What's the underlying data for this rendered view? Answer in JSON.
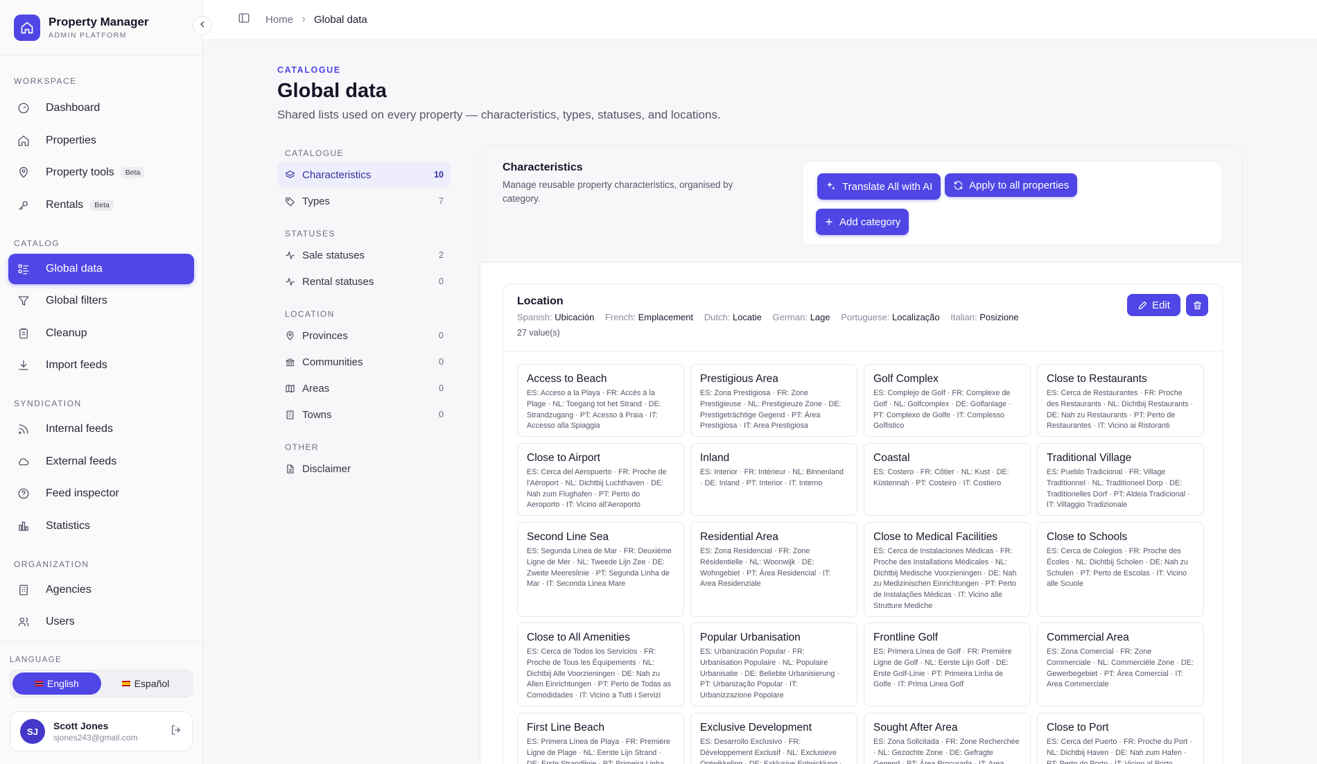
{
  "brand": {
    "title": "Property Manager",
    "subtitle": "ADMIN PLATFORM"
  },
  "sidebar": {
    "sections": [
      {
        "label": "WORKSPACE",
        "items": [
          {
            "label": "Dashboard",
            "icon": "gauge-icon"
          },
          {
            "label": "Properties",
            "icon": "home-icon"
          },
          {
            "label": "Property tools",
            "icon": "pin-icon",
            "badge": "Beta"
          },
          {
            "label": "Rentals",
            "icon": "key-icon",
            "badge": "Beta"
          }
        ]
      },
      {
        "label": "CATALOG",
        "items": [
          {
            "label": "Global data",
            "icon": "list-icon",
            "active": true
          },
          {
            "label": "Global filters",
            "icon": "filter-icon"
          },
          {
            "label": "Cleanup",
            "icon": "clipboard-icon"
          },
          {
            "label": "Import feeds",
            "icon": "download-icon"
          }
        ]
      },
      {
        "label": "SYNDICATION",
        "items": [
          {
            "label": "Internal feeds",
            "icon": "rss-icon"
          },
          {
            "label": "External feeds",
            "icon": "cloud-icon"
          },
          {
            "label": "Feed inspector",
            "icon": "help-icon"
          },
          {
            "label": "Statistics",
            "icon": "bar-chart-icon"
          }
        ]
      },
      {
        "label": "ORGANIZATION",
        "items": [
          {
            "label": "Agencies",
            "icon": "building-icon"
          },
          {
            "label": "Users",
            "icon": "users-icon"
          }
        ]
      }
    ],
    "language": {
      "label": "LANGUAGE",
      "options": [
        "English",
        "Español"
      ],
      "selected": "English"
    },
    "user": {
      "initials": "SJ",
      "name": "Scott Jones",
      "email": "sjones243@gmail.com"
    }
  },
  "breadcrumb": {
    "home": "Home",
    "current": "Global data"
  },
  "page": {
    "eyebrow": "CATALOGUE",
    "title": "Global data",
    "description": "Shared lists used on every property — characteristics, types, statuses, and locations."
  },
  "subnav": [
    {
      "label": "CATALOGUE",
      "items": [
        {
          "label": "Characteristics",
          "count": "10",
          "icon": "layers-icon",
          "active": true
        },
        {
          "label": "Types",
          "count": "7",
          "icon": "tag-icon"
        }
      ]
    },
    {
      "label": "STATUSES",
      "items": [
        {
          "label": "Sale statuses",
          "count": "2",
          "icon": "activity-icon"
        },
        {
          "label": "Rental statuses",
          "count": "0",
          "icon": "activity-icon"
        }
      ]
    },
    {
      "label": "LOCATION",
      "items": [
        {
          "label": "Provinces",
          "count": "0",
          "icon": "pin-icon"
        },
        {
          "label": "Communities",
          "count": "0",
          "icon": "landmark-icon"
        },
        {
          "label": "Areas",
          "count": "0",
          "icon": "map-icon"
        },
        {
          "label": "Towns",
          "count": "0",
          "icon": "building-icon"
        }
      ]
    },
    {
      "label": "OTHER",
      "items": [
        {
          "label": "Disclaimer",
          "count": "",
          "icon": "file-icon"
        }
      ]
    }
  ],
  "panel": {
    "title": "Characteristics",
    "description": "Manage reusable property characteristics, organised by category.",
    "buttons": {
      "translate": "Translate All with AI",
      "apply": "Apply to all properties",
      "add": "Add category"
    },
    "group": {
      "title": "Location",
      "translations": [
        {
          "lang": "Spanish:",
          "value": "Ubicación"
        },
        {
          "lang": "French:",
          "value": "Emplacement"
        },
        {
          "lang": "Dutch:",
          "value": "Locatie"
        },
        {
          "lang": "German:",
          "value": "Lage"
        },
        {
          "lang": "Portuguese:",
          "value": "Localização"
        },
        {
          "lang": "Italian:",
          "value": "Posizione"
        }
      ],
      "count": "27 value(s)",
      "edit_label": "Edit",
      "values": [
        {
          "title": "Access to Beach",
          "tr": "ES: Acceso a la Playa · FR: Accès à la Plage · NL: Toegang tot het Strand · DE: Strandzugang · PT: Acesso à Praia · IT: Accesso alla Spiaggia"
        },
        {
          "title": "Prestigious Area",
          "tr": "ES: Zona Prestigiosa · FR: Zone Prestigieuse · NL: Prestigieuze Zone · DE: Prestigeträchtige Gegend · PT: Área Prestigiosa · IT: Area Prestigiosa"
        },
        {
          "title": "Golf Complex",
          "tr": "ES: Complejo de Golf · FR: Complexe de Golf · NL: Golfcomplex · DE: Golfanlage · PT: Complexo de Golfe · IT: Complesso Golfistico"
        },
        {
          "title": "Close to Restaurants",
          "tr": "ES: Cerca de Restaurantes · FR: Proche des Restaurants · NL: Dichtbij Restaurants · DE: Nah zu Restaurants · PT: Perto de Restaurantes · IT: Vicino ai Ristoranti"
        },
        {
          "title": "Close to Airport",
          "tr": "ES: Cerca del Aeropuerto · FR: Proche de l'Aéroport · NL: Dichtbij Luchthaven · DE: Nah zum Flughafen · PT: Perto do Aeroporto · IT: Vicino all'Aeroporto"
        },
        {
          "title": "Inland",
          "tr": "ES: Interior · FR: Intérieur · NL: Binnenland · DE: Inland · PT: Interior · IT: Interno"
        },
        {
          "title": "Coastal",
          "tr": "ES: Costero · FR: Côtier · NL: Kust · DE: Küstennah · PT: Costeiro · IT: Costiero"
        },
        {
          "title": "Traditional Village",
          "tr": "ES: Pueblo Tradicional · FR: Village Traditionnel · NL: Traditioneel Dorp · DE: Traditionelles Dorf · PT: Aldeia Tradicional · IT: Villaggio Tradizionale"
        },
        {
          "title": "Second Line Sea",
          "tr": "ES: Segunda Línea de Mar · FR: Deuxième Ligne de Mer · NL: Tweede Lijn Zee · DE: Zweite Meereslinie · PT: Segunda Linha de Mar · IT: Seconda Linea Mare"
        },
        {
          "title": "Residential Area",
          "tr": "ES: Zona Residencial · FR: Zone Résidentielle · NL: Woonwijk · DE: Wohngebiet · PT: Área Residencial · IT: Area Residenziale"
        },
        {
          "title": "Close to Medical Facilities",
          "tr": "ES: Cerca de Instalaciones Médicas · FR: Proche des Installations Médicales · NL: Dichtbij Medische Voorzieningen · DE: Nah zu Medizinischen Einrichtungen · PT: Perto de Instalações Médicas · IT: Vicino alle Strutture Mediche"
        },
        {
          "title": "Close to Schools",
          "tr": "ES: Cerca de Colegios · FR: Proche des Écoles · NL: Dichtbij Scholen · DE: Nah zu Schulen · PT: Perto de Escolas · IT: Vicino alle Scuole"
        },
        {
          "title": "Close to All Amenities",
          "tr": "ES: Cerca de Todos los Servicios · FR: Proche de Tous les Équipements · NL: Dichtbij Alle Voorzieningen · DE: Nah zu Allen Einrichtungen · PT: Perto de Todas as Comodidades · IT: Vicino a Tutti i Servizi"
        },
        {
          "title": "Popular Urbanisation",
          "tr": "ES: Urbanización Popular · FR: Urbanisation Populaire · NL: Populaire Urbanisatie · DE: Beliebte Urbanisierung · PT: Urbanização Popular · IT: Urbanizzazione Popolare"
        },
        {
          "title": "Frontline Golf",
          "tr": "ES: Primera Línea de Golf · FR: Première Ligne de Golf · NL: Eerste Lijn Golf · DE: Erste Golf-Linie · PT: Primeira Linha de Golfe · IT: Prima Linea Golf"
        },
        {
          "title": "Commercial Area",
          "tr": "ES: Zona Comercial · FR: Zone Commerciale · NL: Commerciële Zone · DE: Gewerbegebiet · PT: Área Comercial · IT: Area Commerciale"
        },
        {
          "title": "First Line Beach",
          "tr": "ES: Primera Línea de Playa · FR: Première Ligne de Plage · NL: Eerste Lijn Strand · DE: Erste Strandlinie · PT: Primeira Linha de Praia · IT: Prima Linea Spiaggia"
        },
        {
          "title": "Exclusive Development",
          "tr": "ES: Desarrollo Exclusivo · FR: Développement Exclusif · NL: Exclusieve Ontwikkeling · DE: Exklusive Entwicklung · PT: Empreendimento Exclusivo"
        },
        {
          "title": "Sought After Area",
          "tr": "ES: Zona Solicitada · FR: Zone Recherchée · NL: Gezochte Zone · DE: Gefragte Gegend · PT: Área Procurada · IT: Area Ricercata"
        },
        {
          "title": "Close to Port",
          "tr": "ES: Cerca del Puerto · FR: Proche du Port · NL: Dichtbij Haven · DE: Nah zum Hafen · PT: Perto do Porto · IT: Vicino al Porto"
        }
      ]
    }
  },
  "colors": {
    "accent": "#4f46e5",
    "accent_soft": "#ededfb"
  }
}
